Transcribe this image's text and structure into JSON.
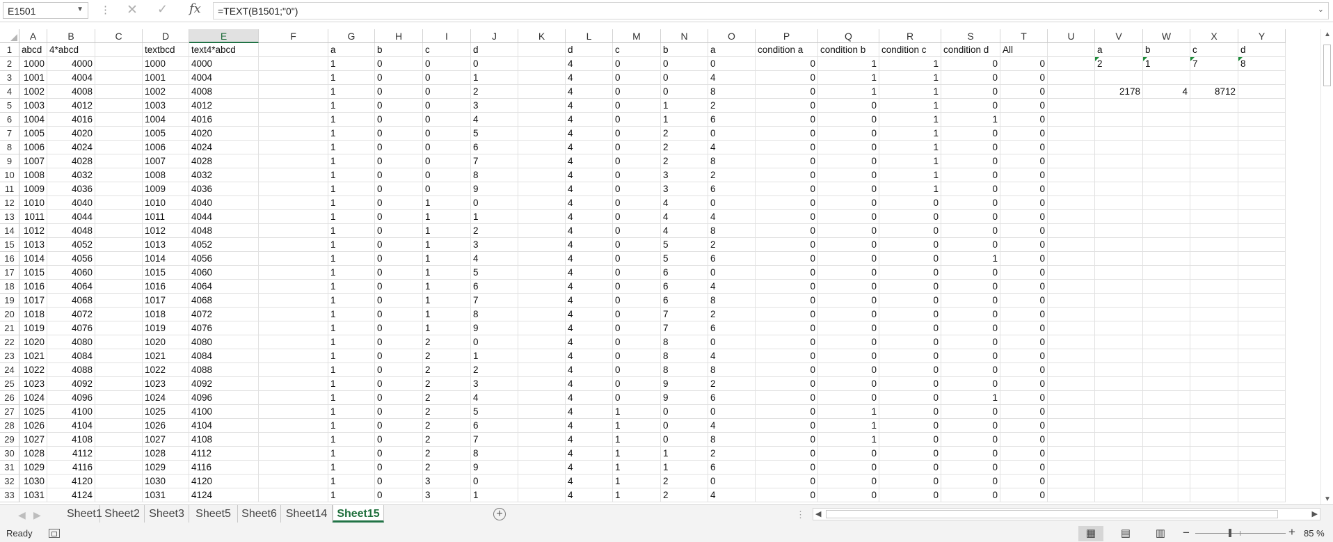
{
  "formula_bar": {
    "name_box": "E1501",
    "formula": "=TEXT(B1501;\"0\")",
    "icons": [
      "options-dots-icon",
      "cancel-x-icon",
      "enter-check-icon",
      "insert-function-icon"
    ]
  },
  "columns": [
    "A",
    "B",
    "C",
    "D",
    "E",
    "F",
    "G",
    "H",
    "I",
    "J",
    "K",
    "L",
    "M",
    "N",
    "O",
    "P",
    "Q",
    "R",
    "S",
    "T",
    "U",
    "V",
    "W",
    "X",
    "Y"
  ],
  "selected_column": "E",
  "row_numbers": [
    "1",
    "2",
    "3",
    "4",
    "5",
    "6",
    "7",
    "8",
    "9",
    "10",
    "11",
    "12",
    "13",
    "14",
    "15",
    "16",
    "17",
    "18",
    "19",
    "20",
    "21",
    "22",
    "23",
    "24",
    "25",
    "26",
    "27",
    "28",
    "29",
    "30",
    "31",
    "32",
    "33"
  ],
  "headers": {
    "A": "abcd",
    "B": "4*abcd",
    "D": "textbcd",
    "E": "text4*abcd",
    "G": "a",
    "H": "b",
    "I": "c",
    "J": "d",
    "L": "d",
    "M": "c",
    "N": "b",
    "O": "a",
    "P": "condition a",
    "Q": "condition b",
    "R": "condition c",
    "S": "condition d",
    "T": "All",
    "V": "a",
    "W": "b",
    "X": "c",
    "Y": "d"
  },
  "side_values": {
    "row2": {
      "V": "2",
      "W": "1",
      "X": "7",
      "Y": "8"
    },
    "row4": {
      "V": "2178",
      "W": "4",
      "X": "8712"
    }
  },
  "table_rows": [
    [
      "1000",
      "4000",
      "1000",
      "4000",
      "1",
      "0",
      "0",
      "0",
      "4",
      "0",
      "0",
      "0",
      "0",
      "1",
      "1",
      "0",
      "0"
    ],
    [
      "1001",
      "4004",
      "1001",
      "4004",
      "1",
      "0",
      "0",
      "1",
      "4",
      "0",
      "0",
      "4",
      "0",
      "1",
      "1",
      "0",
      "0"
    ],
    [
      "1002",
      "4008",
      "1002",
      "4008",
      "1",
      "0",
      "0",
      "2",
      "4",
      "0",
      "0",
      "8",
      "0",
      "1",
      "1",
      "0",
      "0"
    ],
    [
      "1003",
      "4012",
      "1003",
      "4012",
      "1",
      "0",
      "0",
      "3",
      "4",
      "0",
      "1",
      "2",
      "0",
      "0",
      "1",
      "0",
      "0"
    ],
    [
      "1004",
      "4016",
      "1004",
      "4016",
      "1",
      "0",
      "0",
      "4",
      "4",
      "0",
      "1",
      "6",
      "0",
      "0",
      "1",
      "1",
      "0"
    ],
    [
      "1005",
      "4020",
      "1005",
      "4020",
      "1",
      "0",
      "0",
      "5",
      "4",
      "0",
      "2",
      "0",
      "0",
      "0",
      "1",
      "0",
      "0"
    ],
    [
      "1006",
      "4024",
      "1006",
      "4024",
      "1",
      "0",
      "0",
      "6",
      "4",
      "0",
      "2",
      "4",
      "0",
      "0",
      "1",
      "0",
      "0"
    ],
    [
      "1007",
      "4028",
      "1007",
      "4028",
      "1",
      "0",
      "0",
      "7",
      "4",
      "0",
      "2",
      "8",
      "0",
      "0",
      "1",
      "0",
      "0"
    ],
    [
      "1008",
      "4032",
      "1008",
      "4032",
      "1",
      "0",
      "0",
      "8",
      "4",
      "0",
      "3",
      "2",
      "0",
      "0",
      "1",
      "0",
      "0"
    ],
    [
      "1009",
      "4036",
      "1009",
      "4036",
      "1",
      "0",
      "0",
      "9",
      "4",
      "0",
      "3",
      "6",
      "0",
      "0",
      "1",
      "0",
      "0"
    ],
    [
      "1010",
      "4040",
      "1010",
      "4040",
      "1",
      "0",
      "1",
      "0",
      "4",
      "0",
      "4",
      "0",
      "0",
      "0",
      "0",
      "0",
      "0"
    ],
    [
      "1011",
      "4044",
      "1011",
      "4044",
      "1",
      "0",
      "1",
      "1",
      "4",
      "0",
      "4",
      "4",
      "0",
      "0",
      "0",
      "0",
      "0"
    ],
    [
      "1012",
      "4048",
      "1012",
      "4048",
      "1",
      "0",
      "1",
      "2",
      "4",
      "0",
      "4",
      "8",
      "0",
      "0",
      "0",
      "0",
      "0"
    ],
    [
      "1013",
      "4052",
      "1013",
      "4052",
      "1",
      "0",
      "1",
      "3",
      "4",
      "0",
      "5",
      "2",
      "0",
      "0",
      "0",
      "0",
      "0"
    ],
    [
      "1014",
      "4056",
      "1014",
      "4056",
      "1",
      "0",
      "1",
      "4",
      "4",
      "0",
      "5",
      "6",
      "0",
      "0",
      "0",
      "1",
      "0"
    ],
    [
      "1015",
      "4060",
      "1015",
      "4060",
      "1",
      "0",
      "1",
      "5",
      "4",
      "0",
      "6",
      "0",
      "0",
      "0",
      "0",
      "0",
      "0"
    ],
    [
      "1016",
      "4064",
      "1016",
      "4064",
      "1",
      "0",
      "1",
      "6",
      "4",
      "0",
      "6",
      "4",
      "0",
      "0",
      "0",
      "0",
      "0"
    ],
    [
      "1017",
      "4068",
      "1017",
      "4068",
      "1",
      "0",
      "1",
      "7",
      "4",
      "0",
      "6",
      "8",
      "0",
      "0",
      "0",
      "0",
      "0"
    ],
    [
      "1018",
      "4072",
      "1018",
      "4072",
      "1",
      "0",
      "1",
      "8",
      "4",
      "0",
      "7",
      "2",
      "0",
      "0",
      "0",
      "0",
      "0"
    ],
    [
      "1019",
      "4076",
      "1019",
      "4076",
      "1",
      "0",
      "1",
      "9",
      "4",
      "0",
      "7",
      "6",
      "0",
      "0",
      "0",
      "0",
      "0"
    ],
    [
      "1020",
      "4080",
      "1020",
      "4080",
      "1",
      "0",
      "2",
      "0",
      "4",
      "0",
      "8",
      "0",
      "0",
      "0",
      "0",
      "0",
      "0"
    ],
    [
      "1021",
      "4084",
      "1021",
      "4084",
      "1",
      "0",
      "2",
      "1",
      "4",
      "0",
      "8",
      "4",
      "0",
      "0",
      "0",
      "0",
      "0"
    ],
    [
      "1022",
      "4088",
      "1022",
      "4088",
      "1",
      "0",
      "2",
      "2",
      "4",
      "0",
      "8",
      "8",
      "0",
      "0",
      "0",
      "0",
      "0"
    ],
    [
      "1023",
      "4092",
      "1023",
      "4092",
      "1",
      "0",
      "2",
      "3",
      "4",
      "0",
      "9",
      "2",
      "0",
      "0",
      "0",
      "0",
      "0"
    ],
    [
      "1024",
      "4096",
      "1024",
      "4096",
      "1",
      "0",
      "2",
      "4",
      "4",
      "0",
      "9",
      "6",
      "0",
      "0",
      "0",
      "1",
      "0"
    ],
    [
      "1025",
      "4100",
      "1025",
      "4100",
      "1",
      "0",
      "2",
      "5",
      "4",
      "1",
      "0",
      "0",
      "0",
      "1",
      "0",
      "0",
      "0"
    ],
    [
      "1026",
      "4104",
      "1026",
      "4104",
      "1",
      "0",
      "2",
      "6",
      "4",
      "1",
      "0",
      "4",
      "0",
      "1",
      "0",
      "0",
      "0"
    ],
    [
      "1027",
      "4108",
      "1027",
      "4108",
      "1",
      "0",
      "2",
      "7",
      "4",
      "1",
      "0",
      "8",
      "0",
      "1",
      "0",
      "0",
      "0"
    ],
    [
      "1028",
      "4112",
      "1028",
      "4112",
      "1",
      "0",
      "2",
      "8",
      "4",
      "1",
      "1",
      "2",
      "0",
      "0",
      "0",
      "0",
      "0"
    ],
    [
      "1029",
      "4116",
      "1029",
      "4116",
      "1",
      "0",
      "2",
      "9",
      "4",
      "1",
      "1",
      "6",
      "0",
      "0",
      "0",
      "0",
      "0"
    ],
    [
      "1030",
      "4120",
      "1030",
      "4120",
      "1",
      "0",
      "3",
      "0",
      "4",
      "1",
      "2",
      "0",
      "0",
      "0",
      "0",
      "0",
      "0"
    ],
    [
      "1031",
      "4124",
      "1031",
      "4124",
      "1",
      "0",
      "3",
      "1",
      "4",
      "1",
      "2",
      "4",
      "0",
      "0",
      "0",
      "0",
      "0"
    ]
  ],
  "sheet_tabs": [
    "Sheet1",
    "Sheet2",
    "Sheet3",
    "Sheet5",
    "Sheet6",
    "Sheet14",
    "Sheet15"
  ],
  "active_sheet": "Sheet15",
  "status": {
    "ready": "Ready",
    "zoom": "85 %",
    "zoom_percent": 85
  },
  "colors": {
    "accent": "#217346",
    "gridline": "#e1e1e1",
    "header_sel": "#e1e1e1"
  }
}
